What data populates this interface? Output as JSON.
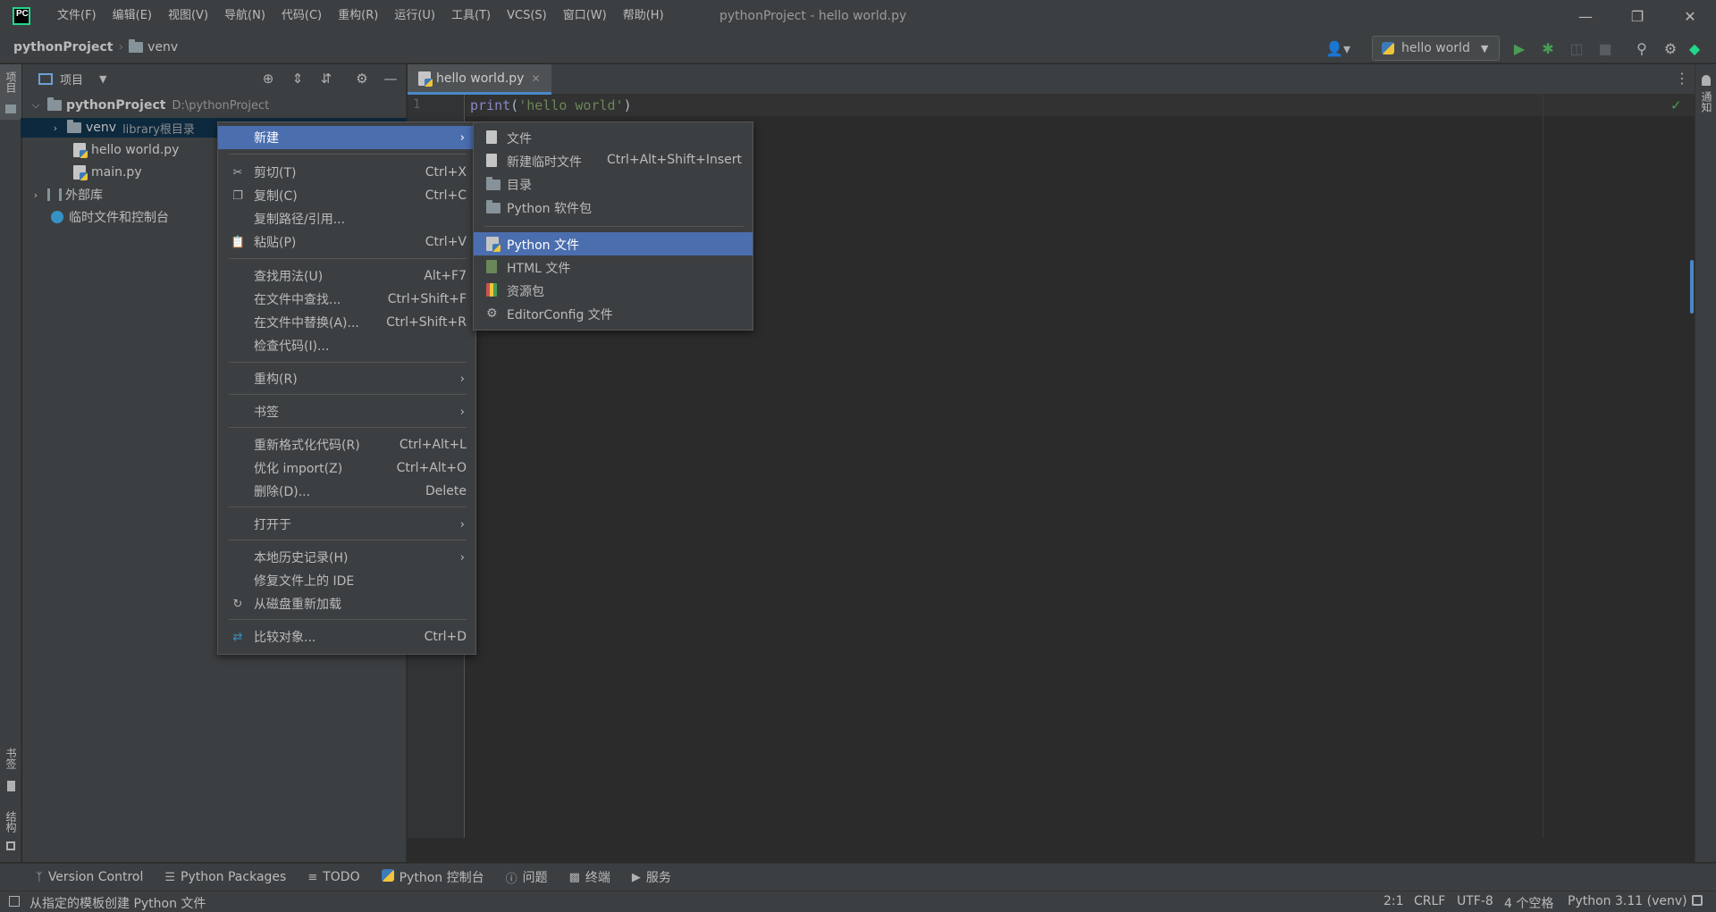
{
  "app": {
    "logo_text": "PC",
    "window_title": "pythonProject - hello world.py"
  },
  "menu": [
    "文件(F)",
    "编辑(E)",
    "视图(V)",
    "导航(N)",
    "代码(C)",
    "重构(R)",
    "运行(U)",
    "工具(T)",
    "VCS(S)",
    "窗口(W)",
    "帮助(H)"
  ],
  "breadcrumb": {
    "root": "pythonProject",
    "child": "venv"
  },
  "run_config": {
    "label": "hello world"
  },
  "left_stripe": {
    "project": "项目",
    "bookmarks": "书签",
    "structure": "结构"
  },
  "right_stripe": {
    "notifications": "通知"
  },
  "project_panel": {
    "title": "项目",
    "tree": [
      {
        "name": "pythonProject",
        "hint": "D:\\pythonProject"
      },
      {
        "name": "venv",
        "hint": "library根目录"
      },
      {
        "name": "hello world.py"
      },
      {
        "name": "main.py"
      },
      {
        "name": "外部库"
      },
      {
        "name": "临时文件和控制台"
      }
    ]
  },
  "editor": {
    "tab": "hello world.py",
    "line_number": "1",
    "code": {
      "fn": "print",
      "open": "(",
      "str": "'hello world'",
      "close": ")"
    }
  },
  "context_menu": [
    {
      "label": "新建",
      "submenu": true
    },
    {
      "label": "剪切(T)",
      "shortcut": "Ctrl+X"
    },
    {
      "label": "复制(C)",
      "shortcut": "Ctrl+C"
    },
    {
      "label": "复制路径/引用..."
    },
    {
      "label": "粘贴(P)",
      "shortcut": "Ctrl+V"
    },
    {
      "label": "查找用法(U)",
      "shortcut": "Alt+F7"
    },
    {
      "label": "在文件中查找...",
      "shortcut": "Ctrl+Shift+F"
    },
    {
      "label": "在文件中替换(A)...",
      "shortcut": "Ctrl+Shift+R"
    },
    {
      "label": "检查代码(I)..."
    },
    {
      "label": "重构(R)",
      "submenu": true
    },
    {
      "label": "书签",
      "submenu": true
    },
    {
      "label": "重新格式化代码(R)",
      "shortcut": "Ctrl+Alt+L"
    },
    {
      "label": "优化 import(Z)",
      "shortcut": "Ctrl+Alt+O"
    },
    {
      "label": "删除(D)...",
      "shortcut": "Delete"
    },
    {
      "label": "打开于",
      "submenu": true
    },
    {
      "label": "本地历史记录(H)",
      "submenu": true
    },
    {
      "label": "修复文件上的 IDE"
    },
    {
      "label": "从磁盘重新加载"
    },
    {
      "label": "比较对象...",
      "shortcut": "Ctrl+D"
    }
  ],
  "new_submenu": [
    {
      "label": "文件"
    },
    {
      "label": "新建临时文件",
      "shortcut": "Ctrl+Alt+Shift+Insert"
    },
    {
      "label": "目录"
    },
    {
      "label": "Python 软件包"
    },
    {
      "label": "Python 文件"
    },
    {
      "label": "HTML 文件"
    },
    {
      "label": "资源包"
    },
    {
      "label": "EditorConfig 文件"
    }
  ],
  "bottom_tools": [
    "Version Control",
    "Python Packages",
    "TODO",
    "Python 控制台",
    "问题",
    "终端",
    "服务"
  ],
  "status": {
    "message": "从指定的模板创建 Python 文件",
    "position": "2:1",
    "line_sep": "CRLF",
    "encoding": "UTF-8",
    "indent": "4 个空格",
    "interpreter": "Python 3.11 (venv)"
  },
  "colors": {
    "selection": "#4b6eaf",
    "accent": "#4a88c7",
    "run_green": "#499c54"
  }
}
